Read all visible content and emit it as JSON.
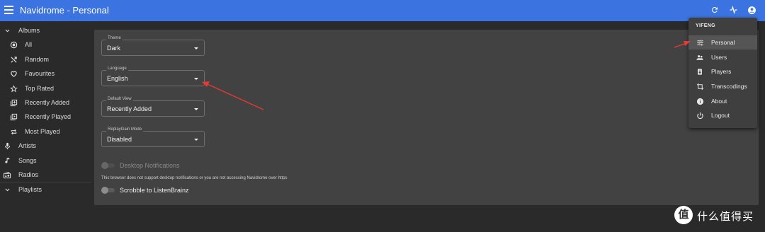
{
  "app": {
    "title": "Navidrome - Personal"
  },
  "appbar": {
    "icons": [
      "refresh-icon",
      "activity-icon",
      "account-icon"
    ]
  },
  "sidebar": {
    "items": [
      {
        "label": "Albums",
        "icon": "chevron-down-icon"
      },
      {
        "label": "All",
        "icon": "album-all-icon"
      },
      {
        "label": "Random",
        "icon": "shuffle-icon"
      },
      {
        "label": "Favourites",
        "icon": "heart-icon"
      },
      {
        "label": "Top Rated",
        "icon": "star-icon"
      },
      {
        "label": "Recently Added",
        "icon": "library-add-icon"
      },
      {
        "label": "Recently Played",
        "icon": "library-play-icon"
      },
      {
        "label": "Most Played",
        "icon": "repeat-icon"
      },
      {
        "label": "Artists",
        "icon": "microphone-icon"
      },
      {
        "label": "Songs",
        "icon": "music-note-icon"
      },
      {
        "label": "Radios",
        "icon": "radio-icon"
      },
      {
        "label": "Playlists",
        "icon": "chevron-down-icon"
      }
    ]
  },
  "settings": {
    "theme": {
      "label": "Theme",
      "value": "Dark"
    },
    "language": {
      "label": "Language",
      "value": "English"
    },
    "default_view": {
      "label": "Default View",
      "value": "Recently Added"
    },
    "replaygain": {
      "label": "ReplayGain Mode",
      "value": "Disabled"
    },
    "desktop_notifications": {
      "label": "Desktop Notifications",
      "enabled": false
    },
    "notification_note": "This browser does not support desktop notifications or you are not accessing Navidrome over https",
    "scrobble": {
      "label": "Scrobble to ListenBrainz",
      "enabled": false
    }
  },
  "user_menu": {
    "username": "YIFENG",
    "items": [
      {
        "label": "Personal",
        "icon": "sliders-icon",
        "selected": true
      },
      {
        "label": "Users",
        "icon": "people-icon"
      },
      {
        "label": "Players",
        "icon": "speaker-icon"
      },
      {
        "label": "Transcodings",
        "icon": "transform-icon"
      },
      {
        "label": "About",
        "icon": "info-icon"
      },
      {
        "label": "Logout",
        "icon": "power-icon"
      }
    ]
  },
  "watermark": {
    "text": "什么值得买",
    "logo_text": "值"
  },
  "colors": {
    "appbar": "#3b74e0",
    "background": "#2a2a2a",
    "panel": "#424242",
    "menu": "#3f3f3f",
    "annotation_arrow": "#e53935"
  }
}
